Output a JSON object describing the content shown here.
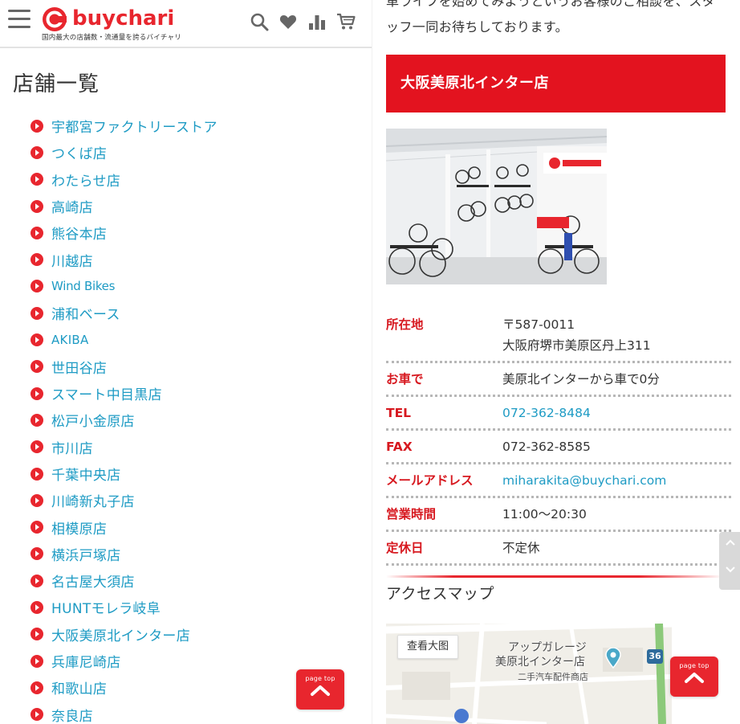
{
  "header": {
    "logo_text": "buychari",
    "tagline": "国内最大の店舗数・流通量を誇るバイチャリ",
    "icons": [
      "menu-icon",
      "search-icon",
      "heart-icon",
      "ranking-icon",
      "cart-icon"
    ]
  },
  "left": {
    "title": "店舗一覧",
    "stores": [
      "宇都宮ファクトリーストア",
      "つくば店",
      "わたらせ店",
      "高崎店",
      "熊谷本店",
      "川越店",
      "Wind Bikes",
      "浦和ベース",
      "AKIBA",
      "世田谷店",
      "スマート中目黒店",
      "松戸小金原店",
      "市川店",
      "千葉中央店",
      "川崎新丸子店",
      "相模原店",
      "横浜戸塚店",
      "名古屋大須店",
      "HUNTモレラ岐阜",
      "大阪美原北インター店",
      "兵庫尼崎店",
      "和歌山店",
      "奈良店"
    ],
    "page_top_label": "page top"
  },
  "right": {
    "intro_line1": "車ライフを始めてみようというお客様のご相談を、スタ",
    "intro_line2": "ッフ一同お待ちしております。",
    "store_name": "大阪美原北インター店",
    "info": {
      "address_label": "所在地",
      "postal": "〒587-0011",
      "address": "大阪府堺市美原区丹上311",
      "car_label": "お車で",
      "car": "美原北インターから車で0分",
      "tel_label": "TEL",
      "tel": "072-362-8484",
      "fax_label": "FAX",
      "fax": "072-362-8585",
      "mail_label": "メールアドレス",
      "mail": "miharakita@buychari.com",
      "hours_label": "営業時間",
      "hours": "11:00〜20:30",
      "holiday_label": "定休日",
      "holiday": "不定休"
    },
    "access_title": "アクセスマップ",
    "map": {
      "view_large": "查看大图",
      "place_line1": "アップガレージ",
      "place_line2": "美原北インター店",
      "place_line3": "二手汽车配件商店",
      "route_number": "36"
    },
    "page_top_label": "page top"
  },
  "colors": {
    "brand_red": "#e8262e",
    "link_blue": "#1e9bc4",
    "label_red": "#d71920"
  }
}
